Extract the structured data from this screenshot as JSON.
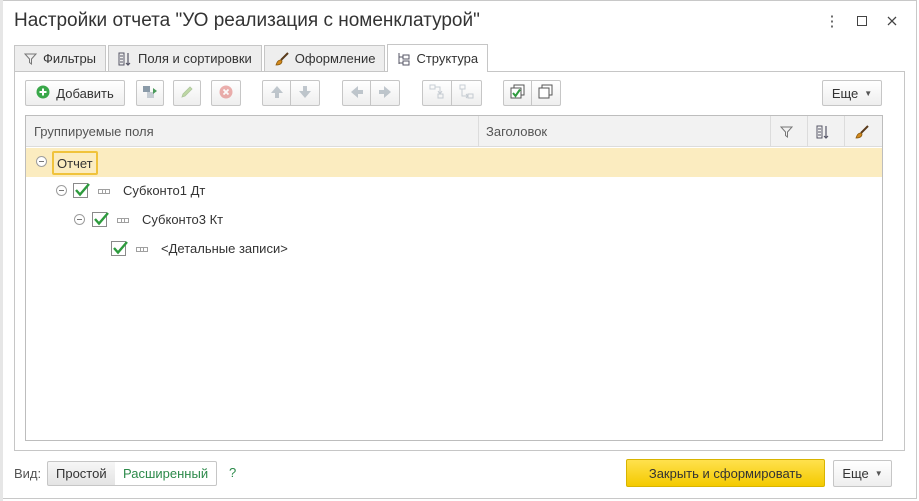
{
  "window": {
    "title": "Настройки отчета \"УО реализация с номенклатурой\"",
    "controls": {
      "more_icon": "⋮",
      "maximize_icon": "□",
      "close_icon": "✕"
    }
  },
  "tabs": [
    {
      "label": "Фильтры",
      "icon": "filter-icon"
    },
    {
      "label": "Поля и сортировки",
      "icon": "sort-fields-icon"
    },
    {
      "label": "Оформление",
      "icon": "brush-icon"
    },
    {
      "label": "Структура",
      "icon": "structure-icon",
      "active": true
    }
  ],
  "toolbar": {
    "add_label": "Добавить",
    "more_label": "Еще"
  },
  "grid": {
    "columns": {
      "fields": "Группируемые поля",
      "title": "Заголовок"
    },
    "rows": [
      {
        "label": "Отчет",
        "level": 0,
        "selected": true
      },
      {
        "label": "Субконто1 Дт",
        "level": 1,
        "checked": true
      },
      {
        "label": "Субконто3 Кт",
        "level": 2,
        "checked": true
      },
      {
        "label": "<Детальные записи>",
        "level": 3,
        "checked": true
      }
    ]
  },
  "footer": {
    "view_label": "Вид:",
    "simple_label": "Простой",
    "extended_label": "Расширенный",
    "help_label": "?",
    "close_generate_label": "Закрыть и сформировать",
    "more_label": "Еще"
  },
  "colors": {
    "accent_yellow": "#f4ca00",
    "selected_row": "#fbecc0",
    "check_green": "#2e9b3e",
    "link_green": "#2c8a4a"
  }
}
